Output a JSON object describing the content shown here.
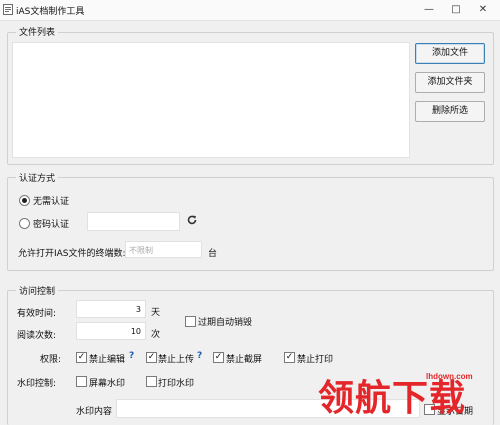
{
  "window": {
    "title": "iAS文档制作工具",
    "controls": {
      "minimize": "—",
      "maximize": "□",
      "close": "✕"
    }
  },
  "file_list": {
    "legend": "文件列表",
    "buttons": {
      "add_file": "添加文件",
      "add_folder": "添加文件夹",
      "delete_selected": "删除所选"
    }
  },
  "auth": {
    "legend": "认证方式",
    "no_auth_label": "无需认证",
    "password_label": "密码认证",
    "password_value": "",
    "max_terminals_label": "允许打开IAS文件的终端数:",
    "max_terminals_placeholder": "不限制",
    "max_terminals_unit": "台",
    "selected": "no_auth"
  },
  "access": {
    "legend": "访问控制",
    "valid_time_label": "有效时间:",
    "valid_time_value": "3",
    "valid_time_unit": "天",
    "read_count_label": "阅读次数:",
    "read_count_value": "10",
    "read_count_unit": "次",
    "auto_destroy_label": "过期自动销毁",
    "permissions_label": "权限:",
    "perm_no_edit": "禁止编辑",
    "perm_no_upload": "禁止上传",
    "perm_no_screenshot": "禁止截屏",
    "perm_no_print": "禁止打印",
    "question": "?",
    "watermark_control_label": "水印控制:",
    "screen_watermark": "屏幕水印",
    "print_watermark": "打印水印",
    "watermark_content_label": "水印内容",
    "show_date_label": "显示日期"
  },
  "overlay": {
    "url": "lhdown.com",
    "brand": "领航下载"
  },
  "colors": {
    "accent": "#1f5fb0",
    "brand_red": "#e4262a"
  }
}
